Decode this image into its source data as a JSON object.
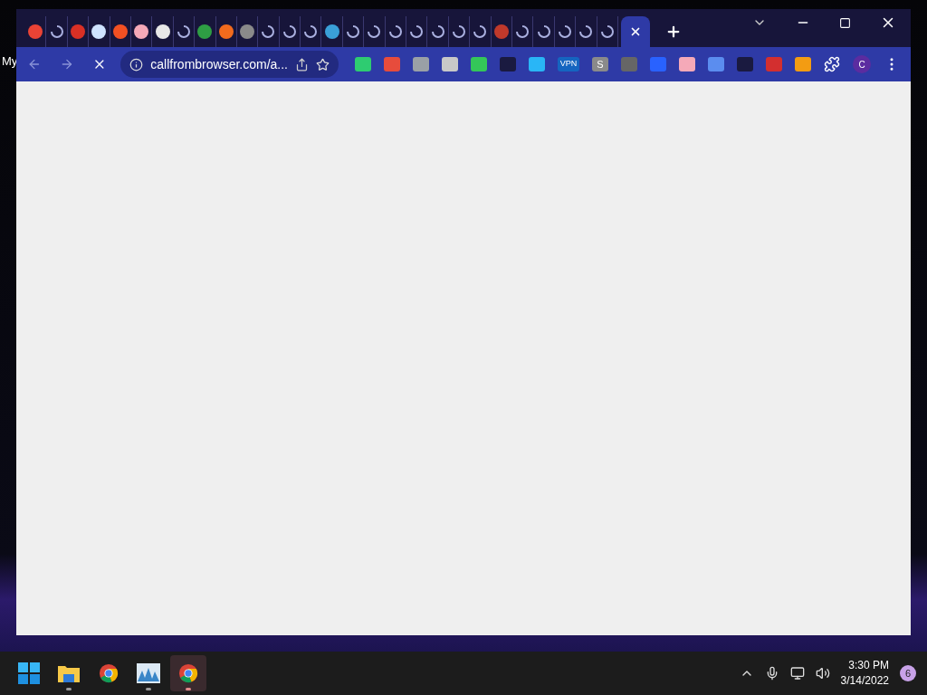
{
  "desktop": {
    "icon_label": "My"
  },
  "tabs": [
    {
      "selected": false,
      "loading": false,
      "color": "#ea4335"
    },
    {
      "selected": false,
      "loading": true
    },
    {
      "selected": false,
      "loading": false,
      "color": "#d93025"
    },
    {
      "selected": false,
      "loading": false,
      "color": "#cfe3ff"
    },
    {
      "selected": false,
      "loading": false,
      "color": "#f25022"
    },
    {
      "selected": false,
      "loading": false,
      "color": "#f5a9b8"
    },
    {
      "selected": false,
      "loading": false,
      "color": "#e8e8e8"
    },
    {
      "selected": false,
      "loading": true
    },
    {
      "selected": false,
      "loading": false,
      "color": "#2e9e44"
    },
    {
      "selected": false,
      "loading": false,
      "color": "#f26b1d"
    },
    {
      "selected": false,
      "loading": false,
      "color": "#8a8a8a"
    },
    {
      "selected": false,
      "loading": true
    },
    {
      "selected": false,
      "loading": true
    },
    {
      "selected": false,
      "loading": true
    },
    {
      "selected": false,
      "loading": false,
      "color": "#3aa0d8"
    },
    {
      "selected": false,
      "loading": true
    },
    {
      "selected": false,
      "loading": true
    },
    {
      "selected": false,
      "loading": true
    },
    {
      "selected": false,
      "loading": true
    },
    {
      "selected": false,
      "loading": true
    },
    {
      "selected": false,
      "loading": true
    },
    {
      "selected": false,
      "loading": true
    },
    {
      "selected": false,
      "loading": false,
      "color": "#c0392b"
    },
    {
      "selected": false,
      "loading": true
    },
    {
      "selected": false,
      "loading": true
    },
    {
      "selected": false,
      "loading": true
    },
    {
      "selected": false,
      "loading": true
    },
    {
      "selected": false,
      "loading": true
    },
    {
      "selected": true
    }
  ],
  "address_bar": {
    "url": "callfrombrowser.com/a..."
  },
  "page": {
    "loading": true
  },
  "extensions": [
    {
      "color": "#2ecc71"
    },
    {
      "color": "#e74c3c"
    },
    {
      "color": "#9aa0a6"
    },
    {
      "color": "#c8c8c8"
    },
    {
      "color": "#34c759"
    },
    {
      "color": "#1a1a40"
    },
    {
      "color": "#29b6f6"
    },
    {
      "color": "#1565c0",
      "label": "VPN"
    },
    {
      "color": "#8a8a8a",
      "label": "S"
    },
    {
      "color": "#666666"
    },
    {
      "color": "#2962ff"
    },
    {
      "color": "#f5a9b8"
    },
    {
      "color": "#5b8def"
    },
    {
      "color": "#1a1a40"
    },
    {
      "color": "#d32f2f"
    },
    {
      "color": "#f39c12"
    }
  ],
  "profile": {
    "initial": "C"
  },
  "taskbar": {
    "apps": [
      {
        "kind": "start",
        "running": false,
        "selected": false
      },
      {
        "kind": "folder",
        "running": true,
        "selected": false
      },
      {
        "kind": "chrome",
        "running": false,
        "selected": false
      },
      {
        "kind": "monitor",
        "running": true,
        "selected": false
      },
      {
        "kind": "chrome",
        "running": true,
        "selected": true
      }
    ]
  },
  "tray": {
    "time": "3:30 PM",
    "date": "3/14/2022",
    "notifications": "6"
  }
}
